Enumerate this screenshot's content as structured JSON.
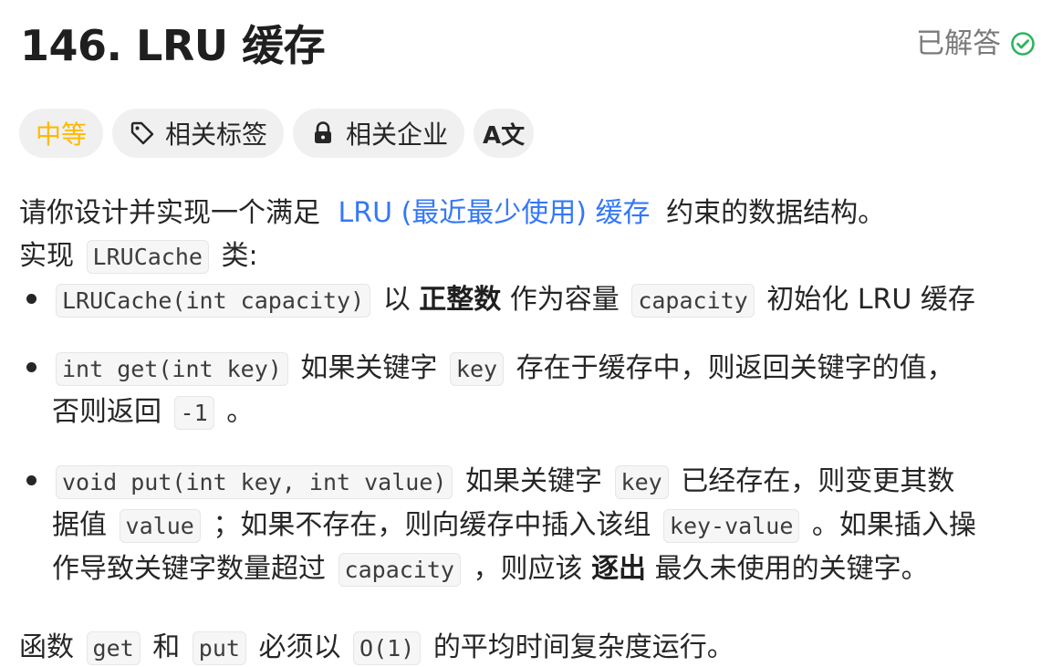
{
  "header": {
    "title": "146. LRU 缓存",
    "solved_label": "已解答",
    "solved_color": "#2db55d"
  },
  "tags": {
    "difficulty": "中等",
    "difficulty_color": "#ffb800",
    "related_tags": "相关标签",
    "related_companies": "相关企业",
    "translate_icon": "translate-icon",
    "translate_glyph": "A文"
  },
  "description": {
    "intro_prefix": "请你设计并实现一个满足",
    "intro_link": "LRU (最近最少使用) 缓存",
    "intro_suffix": "约束的数据结构。",
    "implement_prefix": "实现",
    "implement_code": "LRUCache",
    "implement_suffix": "类:",
    "items": [
      {
        "code1": "LRUCache(int capacity)",
        "t1": "以",
        "bold": "正整数",
        "t2": "作为容量",
        "code2": "capacity",
        "t3": "初始化 LRU 缓存"
      },
      {
        "code1": "int get(int key)",
        "t1": "如果关键字",
        "code2": "key",
        "t2": "存在于缓存中，则返回关键字的值，",
        "t3": "否则返回",
        "code3": "-1",
        "t4": "。"
      },
      {
        "code1": "void put(int key, int value)",
        "t1": "如果关键字",
        "code2": "key",
        "t2": "已经存在，则变更其数",
        "t3": "据值",
        "code3": "value",
        "t4": "；如果不存在，则向缓存中插入该组",
        "code4": "key-value",
        "t5": "。如果插入操",
        "t6": "作导致关键字数量超过",
        "code5": "capacity",
        "t7": "，则应该",
        "bold": "逐出",
        "t8": "最久未使用的关键字。"
      }
    ],
    "final_prefix": "函数",
    "final_code1": "get",
    "final_and": "和",
    "final_code2": "put",
    "final_mid": "必须以",
    "final_code3": "O(1)",
    "final_suffix": "的平均时间复杂度运行。"
  }
}
